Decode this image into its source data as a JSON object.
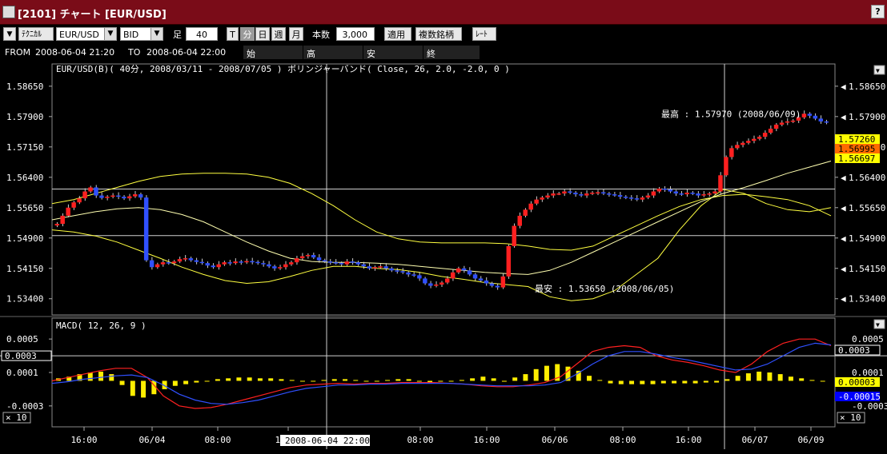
{
  "window": {
    "title": "[2101] チャート [EUR/USD]",
    "help_label": "?",
    "close_label": "×"
  },
  "toolbar": {
    "menu_arrow": "▼",
    "technical_label": "ﾃｸﾆｶﾙ",
    "symbol": "EUR/USD",
    "price_type": "BID",
    "bar_label": "足",
    "bar_minutes": "40",
    "bar_units": [
      "T",
      "分",
      "日",
      "週",
      "月"
    ],
    "bar_unit_selected": "分",
    "count_label": "本数",
    "count_value": "3,000",
    "apply_label": "適用",
    "multi_symbol_label": "複数銘柄",
    "rate_label": "ﾚｰﾄ"
  },
  "rangebar": {
    "from_label": "FROM",
    "from_value": "2008-06-04  21:20",
    "to_label": "TO",
    "to_value": "2008-06-04  22:00",
    "open_label": "始",
    "high_label": "高",
    "low_label": "安",
    "close_label": "終"
  },
  "chart_data": [
    {
      "type": "candlestick",
      "title": "EUR/USD(B)( 40分, 2008/03/11 - 2008/07/05 )   ボリンジャーバンド( Close, 26, 2.0, -2.0, 0 )",
      "ylim": [
        1.53,
        1.592
      ],
      "yticks": [
        1.534,
        1.5415,
        1.549,
        1.5565,
        1.564,
        1.5715,
        1.579,
        1.5865
      ],
      "ytick_labels": [
        "1.53400",
        "1.54150",
        "1.54900",
        "1.55650",
        "1.56400",
        "1.57150",
        "1.57900",
        "1.58650"
      ],
      "xtick_labels": [
        "16:00",
        "06/04",
        "08:00",
        "16:00",
        "08:00",
        "16:00",
        "06/06",
        "08:00",
        "16:00",
        "06/07",
        "06/09"
      ],
      "crosshair_time_label": "2008-06-04  22:00",
      "price_labels": [
        {
          "value": 1.5726,
          "text": "1.57260",
          "color": "#ffff00"
        },
        {
          "value": 1.5707,
          "text": "1.56995",
          "color": "#ff6a00"
        },
        {
          "value": 1.5669,
          "text": "1.56697",
          "color": "#ffff00"
        }
      ],
      "annotations": [
        {
          "text": "最高 : 1.57970 (2008/06/09)",
          "value": 1.5797
        },
        {
          "text": "最安 : 1.53650 (2008/06/05)",
          "value": 1.5365
        }
      ],
      "close_path": [
        1.5525,
        1.5545,
        1.5565,
        1.5578,
        1.5588,
        1.5605,
        1.5615,
        1.5595,
        1.5589,
        1.5592,
        1.5595,
        1.5592,
        1.5588,
        1.5593,
        1.5598,
        1.559,
        1.5435,
        1.5418,
        1.5425,
        1.543,
        1.5428,
        1.5432,
        1.5438,
        1.544,
        1.5435,
        1.5431,
        1.5428,
        1.5422,
        1.5418,
        1.5425,
        1.543,
        1.5428,
        1.5432,
        1.543,
        1.5433,
        1.5431,
        1.5428,
        1.5425,
        1.542,
        1.5415,
        1.5418,
        1.5425,
        1.543,
        1.544,
        1.5445,
        1.5448,
        1.5442,
        1.5435,
        1.5432,
        1.543,
        1.5428,
        1.5425,
        1.5432,
        1.543,
        1.5425,
        1.542,
        1.5415,
        1.5418,
        1.542,
        1.5415,
        1.541,
        1.5408,
        1.5405,
        1.54,
        1.5398,
        1.539,
        1.5378,
        1.5372,
        1.5375,
        1.538,
        1.539,
        1.5405,
        1.5415,
        1.541,
        1.54,
        1.539,
        1.5385,
        1.5378,
        1.5372,
        1.5368,
        1.5395,
        1.547,
        1.552,
        1.5545,
        1.556,
        1.5575,
        1.5585,
        1.559,
        1.5595,
        1.56,
        1.56,
        1.5605,
        1.5602,
        1.5598,
        1.5595,
        1.56,
        1.5602,
        1.5603,
        1.56,
        1.5598,
        1.5596,
        1.5592,
        1.559,
        1.5588,
        1.5585,
        1.559,
        1.5595,
        1.5605,
        1.5612,
        1.561,
        1.5605,
        1.56,
        1.5598,
        1.5602,
        1.56,
        1.5595,
        1.5598,
        1.56,
        1.5605,
        1.5645,
        1.569,
        1.5712,
        1.572,
        1.5725,
        1.573,
        1.5735,
        1.574,
        1.575,
        1.576,
        1.577,
        1.5775,
        1.5778,
        1.578,
        1.5788,
        1.5797,
        1.5792,
        1.5785,
        1.5778,
        1.5775
      ],
      "bollinger": {
        "upper": [
          1.5575,
          1.5585,
          1.56,
          1.5615,
          1.563,
          1.5642,
          1.5648,
          1.565,
          1.565,
          1.5648,
          1.564,
          1.5625,
          1.56,
          1.557,
          1.5535,
          1.5505,
          1.5488,
          1.548,
          1.5478,
          1.5478,
          1.5478,
          1.5476,
          1.547,
          1.5462,
          1.546,
          1.547,
          1.5495,
          1.552,
          1.5545,
          1.5568,
          1.5585,
          1.5595,
          1.5598,
          1.5592,
          1.5585,
          1.557,
          1.5545
        ],
        "middle": [
          1.5535,
          1.5545,
          1.5555,
          1.5562,
          1.5565,
          1.556,
          1.5548,
          1.553,
          1.5505,
          1.548,
          1.5458,
          1.544,
          1.5432,
          1.543,
          1.543,
          1.5428,
          1.5425,
          1.542,
          1.5415,
          1.541,
          1.5405,
          1.5402,
          1.54,
          1.541,
          1.543,
          1.5455,
          1.548,
          1.5505,
          1.553,
          1.5555,
          1.558,
          1.56,
          1.5615,
          1.5632,
          1.565,
          1.5665,
          1.568
        ],
        "lower": [
          1.551,
          1.5505,
          1.5495,
          1.548,
          1.546,
          1.544,
          1.5418,
          1.54,
          1.5385,
          1.5378,
          1.5382,
          1.5395,
          1.541,
          1.542,
          1.542,
          1.5415,
          1.5412,
          1.5405,
          1.5395,
          1.5388,
          1.538,
          1.5375,
          1.537,
          1.5345,
          1.5335,
          1.534,
          1.536,
          1.54,
          1.544,
          1.551,
          1.557,
          1.561,
          1.56,
          1.5575,
          1.556,
          1.5555,
          1.5565
        ]
      },
      "horizontal_lines": [
        1.5611,
        1.5496
      ]
    },
    {
      "type": "line",
      "title": "MACD( 12, 26, 9 )",
      "ylim": [
        -0.00055,
        0.00075
      ],
      "yticks": [
        0.0005,
        0.0001,
        -0.0003
      ],
      "ytick_labels": [
        "0.0005",
        "0.0001",
        "-0.0003"
      ],
      "left_value_box": "0.0003",
      "multiplier_label": "× 10",
      "price_labels": [
        {
          "value": 0.0003,
          "text": "0.0003",
          "color": "#ffffff"
        },
        {
          "value": 0.0001,
          "text": "0.0001",
          "color": "#ffffff"
        },
        {
          "value": 3e-05,
          "text": "0.00003",
          "color": "#ffff00"
        },
        {
          "value": -0.00015,
          "text": "-0.00015",
          "color": "#0000ff"
        }
      ],
      "series": [
        {
          "name": "MACD",
          "color": "#ff2020",
          "values": [
            0.0,
            4e-05,
            8e-05,
            0.00012,
            0.00015,
            0.00015,
            4e-05,
            -0.00018,
            -0.0003,
            -0.00033,
            -0.00032,
            -0.00028,
            -0.00023,
            -0.00018,
            -0.00013,
            -8e-05,
            -5e-05,
            -4e-05,
            -3e-05,
            -4e-05,
            -3e-05,
            -3e-05,
            -2e-05,
            -2e-05,
            -2e-05,
            -3e-05,
            -4e-05,
            -6e-05,
            -7e-05,
            -7e-05,
            -5e-05,
            -2e-05,
            5e-05,
            0.0002,
            0.00035,
            0.0004,
            0.00042,
            0.0004,
            0.0003,
            0.00025,
            0.00022,
            0.00018,
            0.00013,
            0.0001,
            0.0002,
            0.00035,
            0.00045,
            0.0005,
            0.0005,
            0.00042
          ]
        },
        {
          "name": "Signal",
          "color": "#3050ff",
          "values": [
            -3e-05,
            -1e-05,
            2e-05,
            4e-05,
            6e-05,
            7e-05,
            4e-05,
            -5e-05,
            -0.00016,
            -0.00023,
            -0.00027,
            -0.00028,
            -0.00026,
            -0.00023,
            -0.00018,
            -0.00013,
            -9e-05,
            -7e-05,
            -5e-05,
            -5e-05,
            -4e-05,
            -4e-05,
            -3e-05,
            -3e-05,
            -3e-05,
            -3e-05,
            -4e-05,
            -5e-05,
            -6e-05,
            -6e-05,
            -6e-05,
            -5e-05,
            -2e-05,
            8e-05,
            0.0002,
            0.0003,
            0.00035,
            0.00035,
            0.00032,
            0.00028,
            0.00025,
            0.00021,
            0.00017,
            0.00013,
            0.00014,
            0.0002,
            0.0003,
            0.0004,
            0.00045,
            0.00043
          ]
        }
      ],
      "histogram": [
        3e-05,
        5e-05,
        8e-05,
        0.0001,
        0.00011,
        8e-05,
        -5e-05,
        -0.00018,
        -0.0002,
        -0.00016,
        -0.0001,
        -6e-05,
        -4e-05,
        -2e-05,
        0.0,
        2e-05,
        3e-05,
        4e-05,
        4e-05,
        3e-05,
        3e-05,
        2e-05,
        1e-05,
        0.0,
        0.0,
        1e-05,
        2e-05,
        2e-05,
        1e-05,
        0.0,
        0.0,
        1e-05,
        2e-05,
        2e-05,
        -1e-05,
        -2e-05,
        -1e-05,
        0.0,
        1e-05,
        3e-05,
        5e-05,
        3e-05,
        -1e-05,
        4e-05,
        8e-05,
        0.00014,
        0.00018,
        0.0002,
        0.00017,
        0.00012,
        6e-05,
        1e-05,
        -3e-05,
        -4e-05,
        -4e-05,
        -4e-05,
        -4e-05,
        -3e-05,
        -3e-05,
        -3e-05,
        -3e-05,
        -2e-05,
        -2e-05,
        2e-05,
        6e-05,
        9e-05,
        0.00011,
        0.0001,
        8e-05,
        5e-05,
        3e-05,
        1e-05,
        0.0
      ]
    }
  ],
  "colors": {
    "titlebar": "#7a0c18",
    "up_candle": "#ff2020",
    "down_candle": "#3050ff",
    "bollinger": "#ffff40",
    "midline": "#ffffb0"
  }
}
